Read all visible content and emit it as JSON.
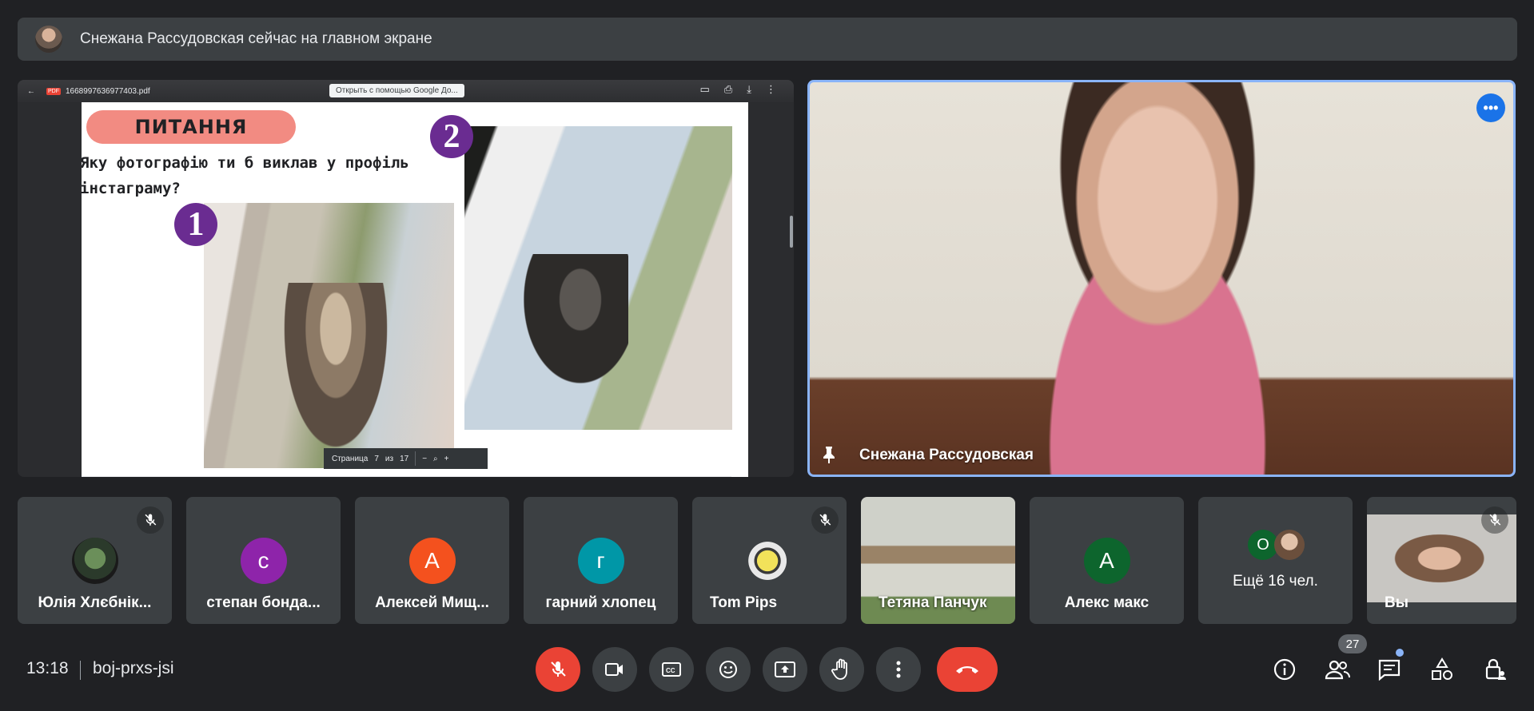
{
  "banner": {
    "text": "Снежана Рассудовская сейчас на главном экране"
  },
  "presentation": {
    "pdf_filename": "1668997636977403.pdf",
    "open_with_label": "Открыть с помощью Google До...",
    "slide_title": "ПИТАННЯ",
    "slide_question": "Яку фотографію ти б виклав у профіль інстаграму?",
    "badge_1": "1",
    "badge_2": "2",
    "page_label": "Страница",
    "page_current": "7",
    "page_of": "из",
    "page_total": "17"
  },
  "speaker": {
    "name": "Снежана Рассудовская"
  },
  "participants": [
    {
      "name": "Юлія Хлєбнік...",
      "initial": "",
      "color": "#3c4043",
      "muted": true
    },
    {
      "name": "степан бонда...",
      "initial": "с",
      "color": "#8e24aa",
      "muted": false
    },
    {
      "name": "Алексей Мищ...",
      "initial": "А",
      "color": "#f4511e",
      "muted": false
    },
    {
      "name": "гарний хлопец",
      "initial": "г",
      "color": "#0097a7",
      "muted": false
    },
    {
      "name": "Tom Pips",
      "initial": "",
      "color": "#3c4043",
      "muted": true
    },
    {
      "name": "Тетяна Панчук",
      "initial": "",
      "color": "",
      "muted": false
    },
    {
      "name": "Алекс макс",
      "initial": "А",
      "color": "#0d652d",
      "muted": false
    }
  ],
  "more": {
    "initial": "О",
    "label": "Ещё 16 чел."
  },
  "you": {
    "name": "Вы"
  },
  "bottom": {
    "time": "13:18",
    "meeting_code": "boj-prxs-jsi",
    "participant_count": "27"
  },
  "colors": {
    "accent": "#8ab4f8",
    "danger": "#ea4335",
    "surface": "#3c4043",
    "background": "#202124"
  }
}
